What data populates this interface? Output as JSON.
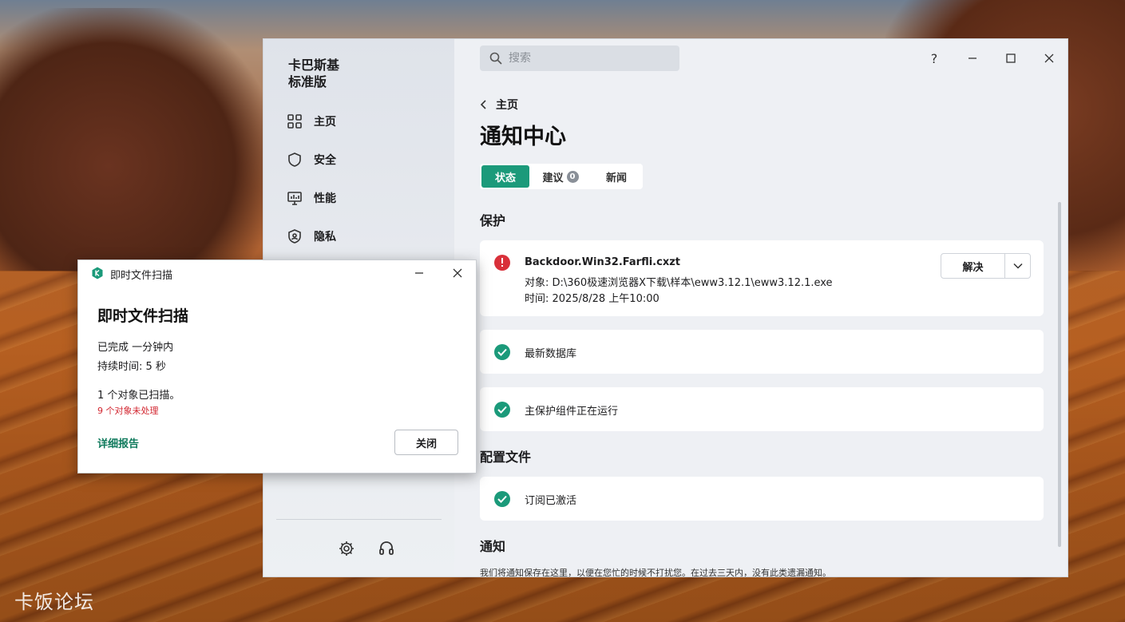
{
  "desktop": {
    "watermark": "卡饭论坛"
  },
  "app": {
    "brand_line1": "卡巴斯基",
    "brand_line2": "标准版",
    "nav": [
      {
        "label": "主页",
        "icon": "grid-icon"
      },
      {
        "label": "安全",
        "icon": "shield-icon"
      },
      {
        "label": "性能",
        "icon": "monitor-icon"
      },
      {
        "label": "隐私",
        "icon": "privacy-shield-icon"
      }
    ],
    "search_placeholder": "搜索",
    "window_controls": {
      "help": "?"
    },
    "back_label": "主页",
    "page_title": "通知中心",
    "tabs": [
      {
        "label": "状态",
        "active": true
      },
      {
        "label": "建议",
        "badge": "0"
      },
      {
        "label": "新闻"
      }
    ],
    "sections": {
      "protection": "保护",
      "config": "配置文件",
      "notices": "通知"
    },
    "threat": {
      "name": "Backdoor.Win32.Farfli.cxzt",
      "object": "对象: D:\\360极速浏览器X下载\\样本\\eww3.12.1\\eww3.12.1.exe",
      "time": "时间: 2025/8/28 上午10:00",
      "action": "解决"
    },
    "status_items": {
      "db": "最新数据库",
      "components": "主保护组件正在运行",
      "subscription": "订阅已激活"
    },
    "footer_note": "我们将通知保存在这里，以便在您忙的时候不打扰您。在过去三天内，没有此类遗漏通知。",
    "colors": {
      "accent": "#1b9a7a",
      "danger": "#d9303a"
    }
  },
  "popup": {
    "window_title": "即时文件扫描",
    "heading": "即时文件扫描",
    "completed": "已完成 一分钟内",
    "duration": "持续时间: 5 秒",
    "scanned": "1 个对象已扫描。",
    "unprocessed": "9 个对象未处理",
    "report_link": "详细报告",
    "close_button": "关闭"
  }
}
